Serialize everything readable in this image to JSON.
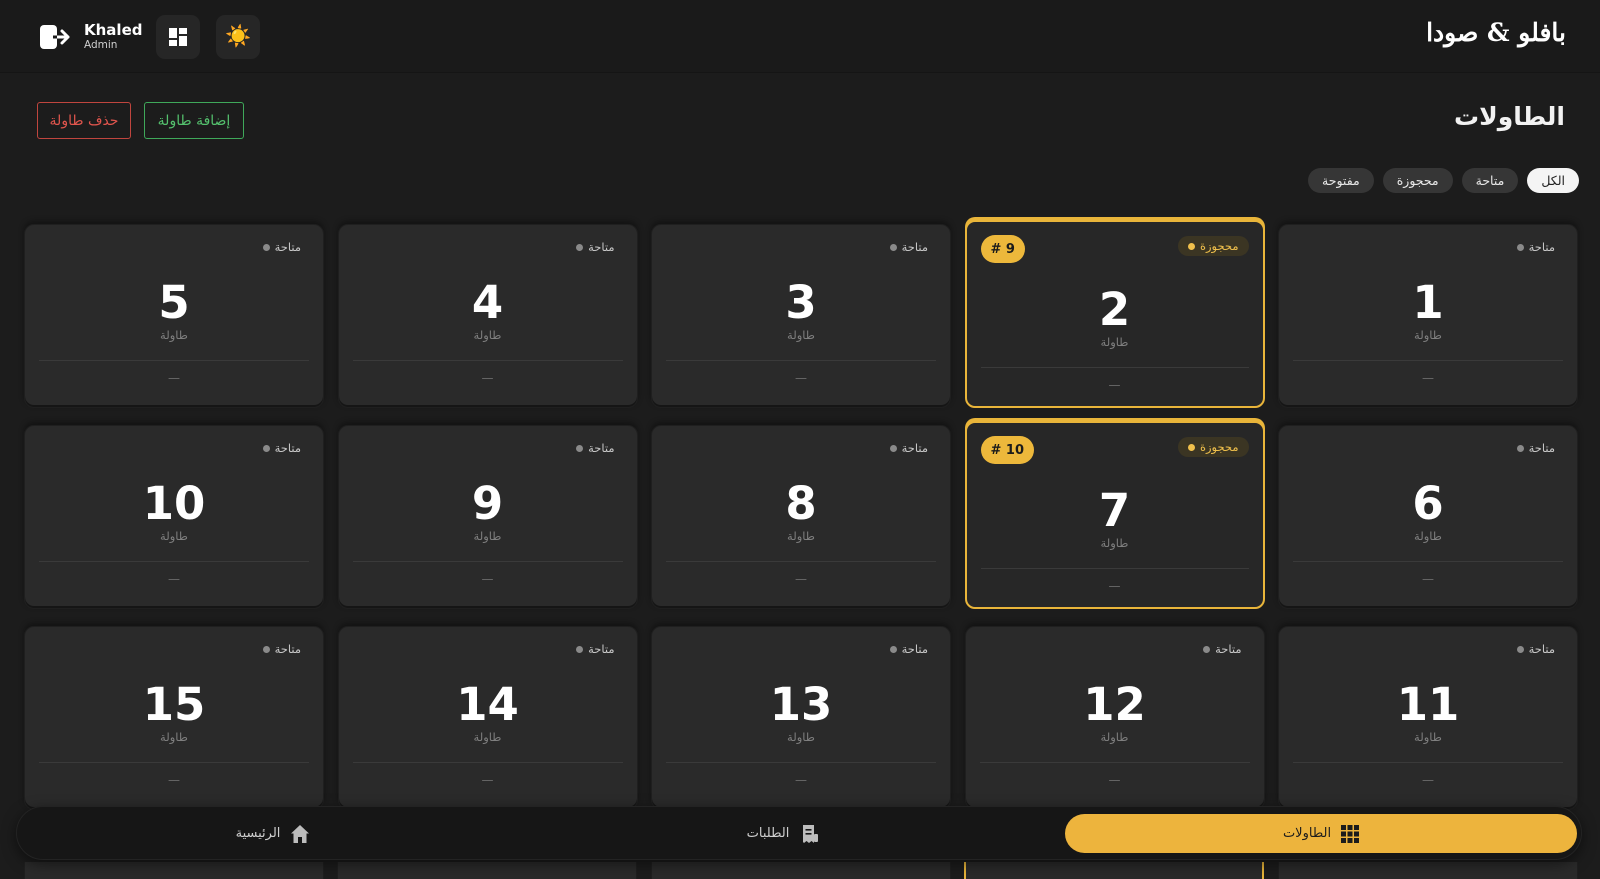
{
  "header": {
    "brand": "بافلو & صودا",
    "user_name": "Khaled",
    "user_role": "Admin",
    "theme_icon": "☀️"
  },
  "page": {
    "title": "الطاولات",
    "add_button": "إضافة طاولة",
    "delete_button": "حذف طاولة"
  },
  "filters": [
    {
      "label": "الكل",
      "active": true
    },
    {
      "label": "متاحة",
      "active": false
    },
    {
      "label": "محجوزة",
      "active": false
    },
    {
      "label": "مفتوحة",
      "active": false
    }
  ],
  "table_label": "طاولة",
  "empty_placeholder": "—",
  "tables": [
    {
      "number": "1",
      "status": "متاحة",
      "reserved": false
    },
    {
      "number": "2",
      "status": "محجوزة",
      "reserved": true,
      "order": "# 9"
    },
    {
      "number": "3",
      "status": "متاحة",
      "reserved": false
    },
    {
      "number": "4",
      "status": "متاحة",
      "reserved": false
    },
    {
      "number": "5",
      "status": "متاحة",
      "reserved": false
    },
    {
      "number": "6",
      "status": "متاحة",
      "reserved": false
    },
    {
      "number": "7",
      "status": "محجوزة",
      "reserved": true,
      "order": "# 10"
    },
    {
      "number": "8",
      "status": "متاحة",
      "reserved": false
    },
    {
      "number": "9",
      "status": "متاحة",
      "reserved": false
    },
    {
      "number": "10",
      "status": "متاحة",
      "reserved": false
    },
    {
      "number": "11",
      "status": "متاحة",
      "reserved": false
    },
    {
      "number": "12",
      "status": "متاحة",
      "reserved": false
    },
    {
      "number": "13",
      "status": "متاحة",
      "reserved": false
    },
    {
      "number": "14",
      "status": "متاحة",
      "reserved": false
    },
    {
      "number": "15",
      "status": "متاحة",
      "reserved": false
    }
  ],
  "bottom_nav": {
    "tables": "الطاولات",
    "orders": "الطلبات",
    "home": "الرئيسية"
  },
  "colors": {
    "accent": "#edb43d",
    "available_dot": "#8a8a8a",
    "reserved_text": "#f0c04c",
    "add_green": "#54c06d",
    "delete_red": "#e0554d"
  }
}
